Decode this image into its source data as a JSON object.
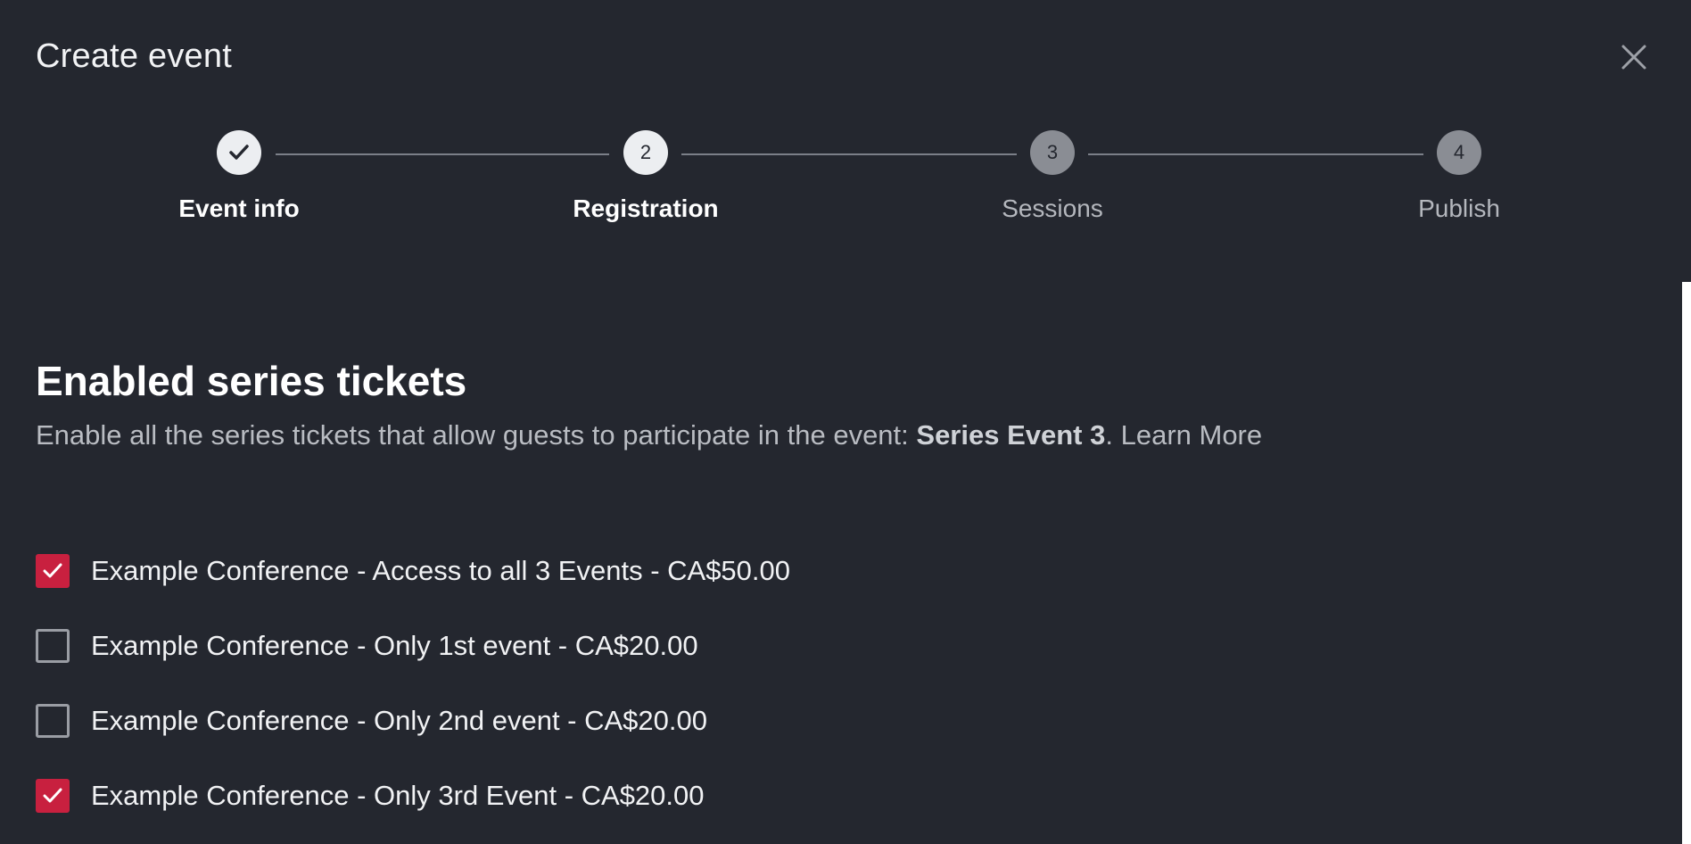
{
  "dialog": {
    "title": "Create event"
  },
  "stepper": {
    "steps": [
      {
        "number": "",
        "label": "Event info",
        "state": "done"
      },
      {
        "number": "2",
        "label": "Registration",
        "state": "active"
      },
      {
        "number": "3",
        "label": "Sessions",
        "state": "pending"
      },
      {
        "number": "4",
        "label": "Publish",
        "state": "pending"
      }
    ]
  },
  "section": {
    "title": "Enabled series tickets",
    "desc_prefix": "Enable all the series tickets that allow guests to participate in the event: ",
    "desc_event": "Series Event 3",
    "desc_sep": ". ",
    "learn_more": "Learn More"
  },
  "tickets": [
    {
      "label": "Example Conference - Access to all 3 Events - CA$50.00",
      "checked": true
    },
    {
      "label": "Example Conference - Only 1st event - CA$20.00",
      "checked": false
    },
    {
      "label": "Example Conference - Only 2nd event - CA$20.00",
      "checked": false
    },
    {
      "label": "Example Conference - Only 3rd Event - CA$20.00",
      "checked": true
    }
  ],
  "colors": {
    "background": "#24272f",
    "accent": "#c8203f",
    "muted_text": "#b9bcc2"
  },
  "icons": {
    "close": "close-icon",
    "check": "check-icon"
  }
}
